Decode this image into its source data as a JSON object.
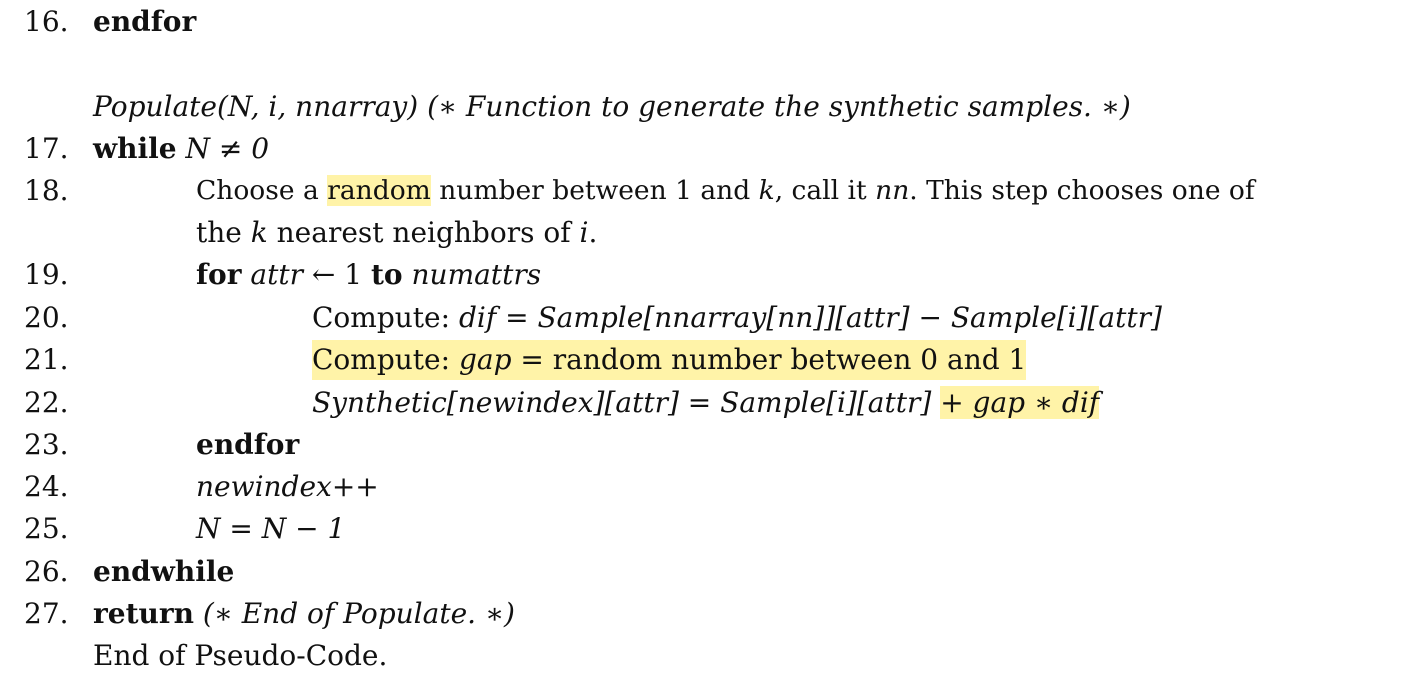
{
  "lines": [
    {
      "num": "16.",
      "kw": "endfor"
    },
    {
      "func": "Populate(N,  i,  nnarray)",
      "comment": "(∗ Function to generate the synthetic samples. ∗)"
    },
    {
      "num": "17.",
      "kw": "while",
      "cond": "N ≠ 0"
    },
    {
      "num": "18.",
      "pre": "Choose a",
      "hl": "random",
      "post_a": "number between 1 and",
      "k1": "k",
      "post_b": ", call it",
      "nn": "nn",
      "post_c": ". This step chooses one of",
      "cont_pre": "the",
      "k2": "k",
      "cont_mid": "nearest neighbors of",
      "i": "i",
      "cont_post": "."
    },
    {
      "num": "19.",
      "kw_for": "for",
      "attr": "attr",
      "arrow": "← 1",
      "kw_to": "to",
      "numattrs": "numattrs"
    },
    {
      "num": "20.",
      "label": "Compute:",
      "expr": "dif = Sample[nnarray[nn]][attr] − Sample[i][attr]"
    },
    {
      "num": "21.",
      "label": "Compute:",
      "gap": "gap",
      "rest": "= random number between 0 and 1"
    },
    {
      "num": "22.",
      "lhs": "Synthetic[newindex][attr] = Sample[i][attr]",
      "hl": "+ gap ∗ dif"
    },
    {
      "num": "23.",
      "kw": "endfor"
    },
    {
      "num": "24.",
      "expr": "newindex++"
    },
    {
      "num": "25.",
      "expr": "N = N − 1"
    },
    {
      "num": "26.",
      "kw": "endwhile"
    },
    {
      "num": "27.",
      "kw": "return",
      "comment": "(∗ End of Populate. ∗)"
    },
    {
      "text": "End of Pseudo-Code."
    }
  ],
  "colors": {
    "highlight": "#fff3a8",
    "text": "#111111"
  }
}
